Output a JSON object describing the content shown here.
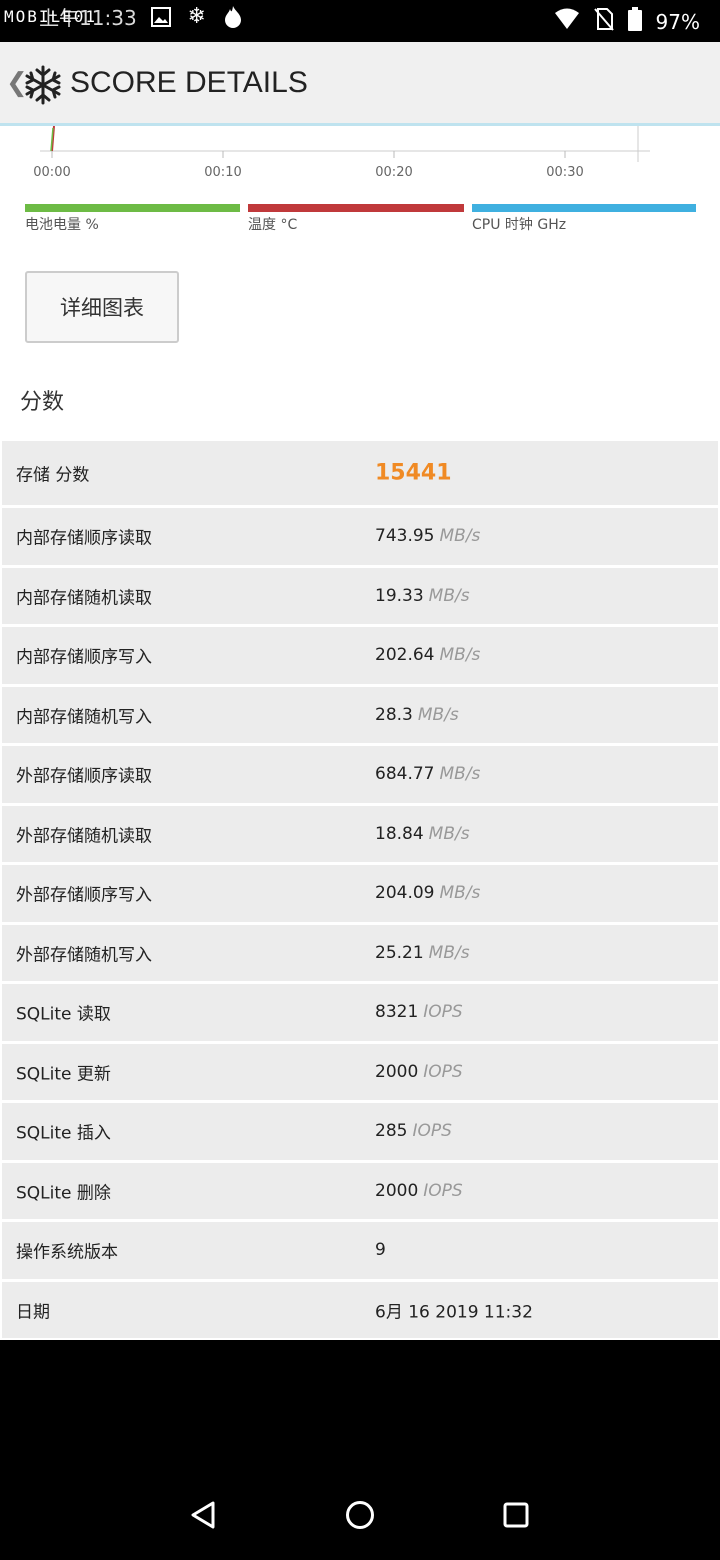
{
  "status_bar": {
    "watermark": "MOBILE01",
    "time": "上午11:33",
    "battery": "97%"
  },
  "app_bar": {
    "title": "SCORE DETAILS"
  },
  "chart": {
    "x_ticks": [
      "00:00",
      "00:10",
      "00:20",
      "00:30"
    ]
  },
  "legend": [
    {
      "label": "电池电量 %",
      "color": "#6dbb45"
    },
    {
      "label": "温度 °C",
      "color": "#c0393b"
    },
    {
      "label": "CPU 时钟 GHz",
      "color": "#3fb0e0"
    }
  ],
  "detail_button": "详细图表",
  "section_title": "分数",
  "scores": [
    {
      "label": "存储 分数",
      "value": "15441",
      "unit": ""
    },
    {
      "label": "内部存储顺序读取",
      "value": "743.95",
      "unit": "MB/s"
    },
    {
      "label": "内部存储随机读取",
      "value": "19.33",
      "unit": "MB/s"
    },
    {
      "label": "内部存储顺序写入",
      "value": "202.64",
      "unit": "MB/s"
    },
    {
      "label": "内部存储随机写入",
      "value": "28.3",
      "unit": "MB/s"
    },
    {
      "label": "外部存储顺序读取",
      "value": "684.77",
      "unit": "MB/s"
    },
    {
      "label": "外部存储随机读取",
      "value": "18.84",
      "unit": "MB/s"
    },
    {
      "label": "外部存储顺序写入",
      "value": "204.09",
      "unit": "MB/s"
    },
    {
      "label": "外部存储随机写入",
      "value": "25.21",
      "unit": "MB/s"
    },
    {
      "label": "SQLite 读取",
      "value": "8321",
      "unit": "IOPS"
    },
    {
      "label": "SQLite 更新",
      "value": "2000",
      "unit": "IOPS"
    },
    {
      "label": "SQLite 插入",
      "value": "285",
      "unit": "IOPS"
    },
    {
      "label": "SQLite 删除",
      "value": "2000",
      "unit": "IOPS"
    },
    {
      "label": "操作系统版本",
      "value": "9",
      "unit": ""
    },
    {
      "label": "日期",
      "value": "6月 16 2019 11:32",
      "unit": ""
    }
  ]
}
